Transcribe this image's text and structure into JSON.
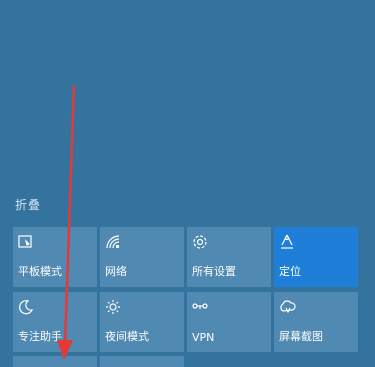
{
  "action_center": {
    "collapse_label": "折叠",
    "tiles": [
      {
        "label": "平板模式",
        "icon": "tablet-mode-icon"
      },
      {
        "label": "网络",
        "icon": "network-icon"
      },
      {
        "label": "所有设置",
        "icon": "settings-gear-icon"
      },
      {
        "label": "定位",
        "icon": "location-icon"
      },
      {
        "label": "专注助手",
        "icon": "moon-icon"
      },
      {
        "label": "夜间模式",
        "icon": "brightness-icon"
      },
      {
        "label": "VPN",
        "icon": "vpn-icon"
      },
      {
        "label": "屏幕截图",
        "icon": "screen-snip-icon"
      }
    ],
    "active_tile": "定位",
    "colors": {
      "background": "#35739f",
      "tile": "#5089b1",
      "tile_active": "#1f7fd8",
      "annotation_arrow": "#e53935"
    }
  }
}
